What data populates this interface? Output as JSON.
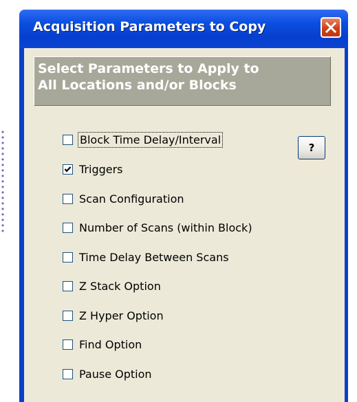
{
  "window": {
    "title": "Acquisition Parameters to Copy",
    "close_icon": "close-icon"
  },
  "header": {
    "line1": "Select Parameters to Apply to",
    "line2": "All Locations and/or Blocks"
  },
  "help_button": {
    "label": "?"
  },
  "options": [
    {
      "label": "Block Time Delay/Interval",
      "checked": false,
      "focused": true
    },
    {
      "label": "Triggers",
      "checked": true,
      "focused": false
    },
    {
      "label": "Scan Configuration",
      "checked": false,
      "focused": false
    },
    {
      "label": "Number of Scans (within Block)",
      "checked": false,
      "focused": false
    },
    {
      "label": "Time Delay Between Scans",
      "checked": false,
      "focused": false
    },
    {
      "label": "Z Stack Option",
      "checked": false,
      "focused": false
    },
    {
      "label": "Z Hyper Option",
      "checked": false,
      "focused": false
    },
    {
      "label": "Find Option",
      "checked": false,
      "focused": false
    },
    {
      "label": "Pause Option",
      "checked": false,
      "focused": false
    }
  ],
  "colors": {
    "title_bar": "#0a4fe0",
    "dialog_bg": "#ece9d8",
    "header_panel": "#a8a89a",
    "close_button": "#cf3f16"
  }
}
